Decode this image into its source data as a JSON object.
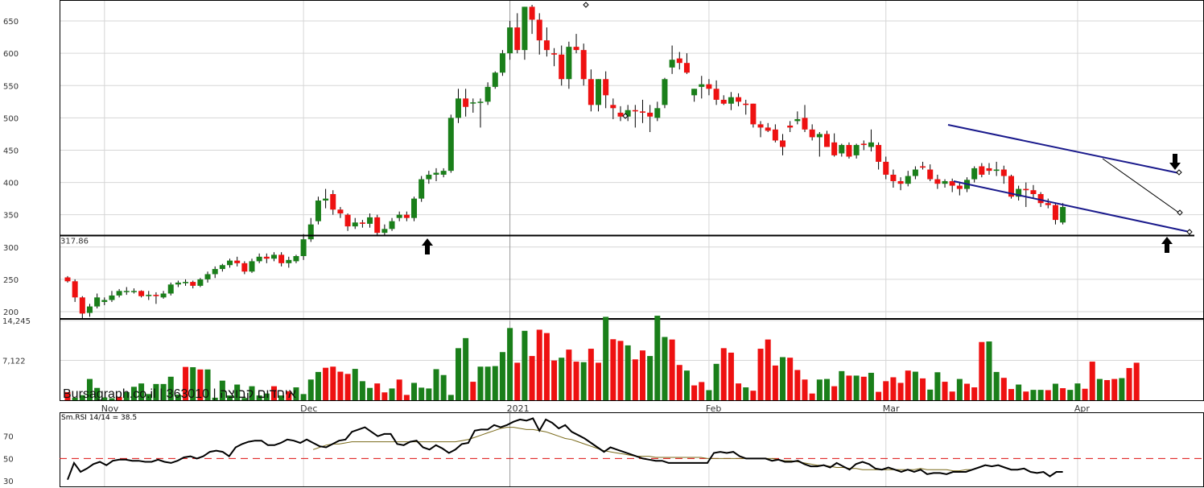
{
  "chart_data": [
    {
      "type": "candlestick",
      "ylim": [
        190,
        680
      ],
      "y_ticks": [
        "650",
        "600",
        "550",
        "500",
        "450",
        "400",
        "350",
        "300",
        "250",
        "200"
      ],
      "support_level": {
        "value": 317.86,
        "label": "317.86"
      },
      "colors": {
        "up": "#1a7f1a",
        "down": "#ee1111",
        "channel": "#1a1a8c",
        "line": "#000000"
      },
      "candles": [
        [
          253,
          255,
          245,
          247
        ],
        [
          247,
          250,
          215,
          222
        ],
        [
          222,
          224,
          190,
          197
        ],
        [
          198,
          212,
          192,
          208
        ],
        [
          208,
          228,
          205,
          222
        ],
        [
          215,
          222,
          210,
          218
        ],
        [
          218,
          232,
          215,
          225
        ],
        [
          225,
          235,
          222,
          232
        ],
        [
          232,
          238,
          226,
          232
        ],
        [
          232,
          236,
          228,
          232
        ],
        [
          232,
          233,
          222,
          224
        ],
        [
          224,
          232,
          218,
          226
        ],
        [
          226,
          230,
          212,
          224
        ],
        [
          222,
          232,
          220,
          228
        ],
        [
          228,
          245,
          225,
          242
        ],
        [
          242,
          248,
          238,
          245
        ],
        [
          244,
          250,
          240,
          246
        ],
        [
          246,
          248,
          236,
          240
        ],
        [
          240,
          252,
          238,
          250
        ],
        [
          250,
          262,
          245,
          258
        ],
        [
          258,
          270,
          252,
          266
        ],
        [
          266,
          274,
          262,
          272
        ],
        [
          272,
          282,
          268,
          279
        ],
        [
          279,
          285,
          270,
          275
        ],
        [
          275,
          278,
          258,
          262
        ],
        [
          262,
          282,
          260,
          278
        ],
        [
          278,
          290,
          275,
          285
        ],
        [
          285,
          290,
          275,
          282
        ],
        [
          282,
          292,
          278,
          288
        ],
        [
          288,
          292,
          270,
          275
        ],
        [
          275,
          285,
          268,
          280
        ],
        [
          278,
          288,
          275,
          286
        ],
        [
          286,
          320,
          280,
          312
        ],
        [
          312,
          345,
          308,
          335
        ],
        [
          340,
          378,
          335,
          372
        ],
        [
          372,
          390,
          360,
          375
        ],
        [
          382,
          388,
          350,
          358
        ],
        [
          358,
          362,
          345,
          352
        ],
        [
          350,
          352,
          325,
          332
        ],
        [
          332,
          345,
          328,
          338
        ],
        [
          338,
          342,
          330,
          336
        ],
        [
          336,
          352,
          330,
          346
        ],
        [
          346,
          350,
          318,
          322
        ],
        [
          322,
          335,
          318,
          328
        ],
        [
          328,
          345,
          325,
          340
        ],
        [
          345,
          355,
          340,
          350
        ],
        [
          350,
          355,
          340,
          345
        ],
        [
          345,
          378,
          340,
          375
        ],
        [
          375,
          410,
          370,
          405
        ],
        [
          405,
          418,
          398,
          412
        ],
        [
          412,
          422,
          402,
          415
        ],
        [
          412,
          422,
          408,
          418
        ],
        [
          418,
          505,
          415,
          500
        ],
        [
          500,
          545,
          492,
          530
        ],
        [
          530,
          545,
          502,
          517
        ],
        [
          523,
          530,
          508,
          524
        ],
        [
          524,
          530,
          485,
          525
        ],
        [
          525,
          555,
          520,
          548
        ],
        [
          548,
          572,
          545,
          570
        ],
        [
          570,
          605,
          565,
          600
        ],
        [
          600,
          650,
          590,
          640
        ],
        [
          640,
          662,
          600,
          605
        ],
        [
          605,
          672,
          590,
          672
        ],
        [
          672,
          675,
          630,
          652
        ],
        [
          652,
          662,
          598,
          620
        ],
        [
          620,
          640,
          595,
          605
        ],
        [
          600,
          608,
          580,
          598
        ],
        [
          598,
          612,
          550,
          560
        ],
        [
          560,
          618,
          545,
          610
        ],
        [
          610,
          630,
          600,
          605
        ],
        [
          605,
          615,
          550,
          560
        ],
        [
          560,
          575,
          510,
          520
        ],
        [
          520,
          560,
          510,
          560
        ],
        [
          560,
          572,
          515,
          535
        ],
        [
          520,
          530,
          498,
          515
        ],
        [
          508,
          518,
          495,
          502
        ],
        [
          502,
          520,
          495,
          512
        ],
        [
          512,
          520,
          485,
          510
        ],
        [
          510,
          528,
          492,
          508
        ],
        [
          508,
          520,
          478,
          502
        ],
        [
          500,
          525,
          495,
          515
        ],
        [
          520,
          562,
          515,
          560
        ],
        [
          578,
          612,
          568,
          590
        ],
        [
          592,
          602,
          575,
          585
        ],
        [
          585,
          600,
          568,
          570
        ],
        [
          535,
          545,
          525,
          545
        ],
        [
          548,
          565,
          530,
          552
        ],
        [
          552,
          560,
          535,
          545
        ],
        [
          545,
          558,
          520,
          528
        ],
        [
          528,
          535,
          520,
          522
        ],
        [
          522,
          540,
          512,
          532
        ],
        [
          532,
          538,
          518,
          525
        ],
        [
          522,
          528,
          505,
          520
        ],
        [
          522,
          522,
          485,
          490
        ],
        [
          490,
          495,
          470,
          485
        ],
        [
          485,
          492,
          478,
          480
        ],
        [
          482,
          490,
          462,
          465
        ],
        [
          465,
          475,
          442,
          455
        ],
        [
          488,
          495,
          478,
          485
        ],
        [
          495,
          510,
          490,
          498
        ],
        [
          500,
          520,
          478,
          482
        ],
        [
          482,
          490,
          465,
          470
        ],
        [
          470,
          478,
          440,
          475
        ],
        [
          475,
          480,
          455,
          455
        ],
        [
          462,
          476,
          440,
          442
        ],
        [
          445,
          460,
          440,
          458
        ],
        [
          458,
          462,
          437,
          440
        ],
        [
          442,
          460,
          437,
          458
        ],
        [
          460,
          465,
          450,
          458
        ],
        [
          455,
          482,
          448,
          462
        ],
        [
          458,
          462,
          420,
          432
        ],
        [
          432,
          440,
          405,
          412
        ],
        [
          412,
          420,
          392,
          402
        ],
        [
          402,
          408,
          388,
          398
        ],
        [
          398,
          418,
          394,
          410
        ],
        [
          410,
          425,
          405,
          420
        ],
        [
          425,
          432,
          420,
          423
        ],
        [
          420,
          428,
          402,
          405
        ],
        [
          405,
          412,
          390,
          398
        ],
        [
          398,
          405,
          392,
          402
        ],
        [
          402,
          406,
          385,
          395
        ],
        [
          395,
          400,
          380,
          390
        ],
        [
          390,
          408,
          385,
          404
        ],
        [
          405,
          425,
          400,
          422
        ],
        [
          425,
          430,
          408,
          412
        ],
        [
          422,
          430,
          412,
          418
        ],
        [
          418,
          432,
          410,
          420
        ],
        [
          420,
          426,
          398,
          410
        ],
        [
          410,
          412,
          375,
          378
        ],
        [
          378,
          395,
          372,
          390
        ],
        [
          390,
          400,
          362,
          388
        ],
        [
          388,
          396,
          375,
          382
        ],
        [
          382,
          385,
          362,
          368
        ],
        [
          368,
          375,
          360,
          365
        ],
        [
          365,
          368,
          335,
          342
        ],
        [
          338,
          368,
          335,
          362
        ]
      ]
    },
    {
      "type": "bar",
      "y_ticks": [
        "14,245",
        "7,122"
      ],
      "ylim": [
        0,
        14245
      ],
      "colors": {
        "up": "#1a7f1a",
        "down": "#ee1111"
      },
      "values": [
        1450,
        450,
        900,
        3800,
        2200,
        500,
        350,
        600,
        1450,
        2400,
        3000,
        1100,
        2900,
        2900,
        4200,
        1000,
        5950,
        5900,
        5500,
        5500,
        450,
        3500,
        850,
        2800,
        400,
        2500,
        850,
        1200,
        2500,
        850,
        1600,
        2300,
        1100,
        3700,
        5050,
        5800,
        6000,
        5100,
        4700,
        5600,
        3400,
        2200,
        3000,
        1400,
        2100,
        3700,
        950,
        3100,
        2250,
        2100,
        5550,
        4500,
        950,
        9300,
        11100,
        3300,
        6000,
        6000,
        6100,
        8600,
        12900,
        6700,
        12400,
        7900,
        12600,
        12000,
        7100,
        7600,
        9050,
        6900,
        6800,
        9200,
        6700,
        14900,
        10900,
        10600,
        9800,
        7300,
        8900,
        7900,
        15100,
        11300,
        10850,
        6300,
        5300,
        2650,
        3250,
        1800,
        6500,
        9300,
        8500,
        3000,
        2300,
        1700,
        9200,
        10850,
        6200,
        7700,
        7600,
        5400,
        3700,
        1200,
        3700,
        3800,
        2500,
        5200,
        4400,
        4400,
        4200,
        4900,
        1500,
        3400,
        4100,
        3100,
        5300,
        5100,
        3900,
        1900,
        5000,
        3300,
        1550,
        3800,
        2950,
        2300,
        10400,
        10500,
        5050,
        4000,
        2000,
        2800,
        1550,
        1850,
        1850,
        1800,
        2950,
        2150,
        1850,
        3000,
        2050,
        6900,
        3800,
        3600,
        3800,
        3950,
        5750,
        6700
      ],
      "directions": [
        "d",
        "u",
        "u",
        "u",
        "u",
        "u",
        "u",
        "d",
        "u",
        "u",
        "u",
        "u",
        "u",
        "u",
        "u",
        "u",
        "d",
        "u",
        "d",
        "u",
        "u",
        "u",
        "u",
        "u",
        "u",
        "u",
        "u",
        "u",
        "d",
        "u",
        "d",
        "u",
        "u",
        "u",
        "u",
        "d",
        "d",
        "d",
        "d",
        "u",
        "u",
        "u",
        "d",
        "d",
        "u",
        "d",
        "d",
        "u",
        "u",
        "u",
        "u",
        "u",
        "u",
        "u",
        "u",
        "d",
        "u",
        "u",
        "u",
        "u",
        "u",
        "d",
        "u",
        "d",
        "d",
        "d",
        "d",
        "u",
        "d",
        "d",
        "u",
        "d",
        "d",
        "u",
        "d",
        "d",
        "u",
        "d",
        "d",
        "u",
        "u",
        "u",
        "d",
        "d",
        "u",
        "d",
        "d",
        "u",
        "u",
        "d",
        "d",
        "d",
        "u",
        "d",
        "d",
        "d",
        "d",
        "u",
        "d",
        "d",
        "d",
        "d",
        "u",
        "u",
        "d",
        "u",
        "d",
        "u",
        "d",
        "u",
        "d",
        "d",
        "d",
        "d",
        "d",
        "u",
        "d",
        "u",
        "u",
        "d",
        "d",
        "u",
        "d",
        "d",
        "d",
        "u",
        "u",
        "d",
        "d",
        "u",
        "d",
        "u",
        "u",
        "d",
        "u",
        "d",
        "u",
        "u",
        "d",
        "d",
        "u",
        "d",
        "d",
        "u",
        "d",
        "d",
        "d",
        "u"
      ]
    },
    {
      "type": "line",
      "title": "Sm.RSI 14/14 = 38.5",
      "ylim": [
        25,
        90
      ],
      "y_ticks": [
        "70",
        "50",
        "30"
      ],
      "reference_line": 50,
      "colors": {
        "rsi": "#000000",
        "smooth": "#7a6a1a",
        "reference": "#dd1111"
      },
      "rsi": [
        31,
        46,
        38,
        41,
        45,
        47,
        44,
        48,
        49,
        49,
        48,
        48,
        47,
        47,
        49,
        47,
        46,
        48,
        51,
        52,
        50,
        52,
        56,
        57,
        56,
        52,
        60,
        63,
        65,
        66,
        66,
        62,
        62,
        64,
        67,
        66,
        64,
        67,
        64,
        61,
        60,
        63,
        66,
        67,
        74,
        76,
        78,
        74,
        70,
        72,
        72,
        63,
        62,
        65,
        66,
        60,
        58,
        62,
        59,
        55,
        58,
        63,
        64,
        75,
        76,
        76,
        80,
        78,
        80,
        83,
        85,
        84,
        86,
        75,
        85,
        82,
        77,
        80,
        74,
        71,
        68,
        64,
        60,
        56,
        60,
        58,
        56,
        54,
        52,
        50,
        49,
        48,
        48,
        46,
        46,
        46,
        46,
        46,
        46,
        46,
        55,
        56,
        55,
        56,
        52,
        50,
        50,
        50,
        50,
        48,
        49,
        47,
        47,
        48,
        45,
        43,
        43,
        44,
        42,
        46,
        43,
        40,
        45,
        47,
        45,
        41,
        40,
        42,
        40,
        38,
        40,
        38,
        40,
        36,
        37,
        37,
        36,
        38,
        38,
        38,
        40,
        42,
        44,
        43,
        44,
        42,
        40,
        40,
        41,
        38,
        37,
        38,
        34,
        38,
        38
      ],
      "smooth": [
        null,
        null,
        null,
        null,
        null,
        null,
        null,
        null,
        null,
        null,
        null,
        null,
        null,
        null,
        null,
        null,
        null,
        null,
        null,
        null,
        null,
        null,
        null,
        null,
        null,
        null,
        null,
        null,
        null,
        null,
        null,
        null,
        null,
        null,
        null,
        null,
        null,
        null,
        58,
        60,
        62,
        63,
        63,
        64,
        65,
        65,
        65,
        65,
        65,
        65,
        65,
        65,
        65,
        65,
        65,
        65,
        65,
        65,
        65,
        65,
        65,
        66,
        67,
        69,
        71,
        73,
        75,
        77,
        78,
        78,
        77,
        76,
        76,
        75,
        74,
        72,
        70,
        68,
        67,
        65,
        63,
        61,
        59,
        57,
        56,
        55,
        54,
        53,
        52,
        52,
        52,
        51,
        51,
        51,
        51,
        51,
        51,
        51,
        51,
        50,
        50,
        50,
        50,
        50,
        50,
        50,
        50,
        50,
        50,
        50,
        49,
        48,
        48,
        47,
        46,
        45,
        44,
        44,
        43,
        42,
        42,
        41,
        41,
        40,
        40,
        40,
        40,
        40,
        40,
        40,
        40,
        40,
        41,
        40,
        40,
        40,
        40,
        39,
        39,
        40,
        40
      ]
    }
  ],
  "axis": {
    "months": [
      "Nov",
      "Dec",
      "2021",
      "Feb",
      "Mar",
      "Apr"
    ]
  },
  "branding": {
    "watermark": "Bursagraph.co.il | 363010 | איחדום קבוצה"
  }
}
